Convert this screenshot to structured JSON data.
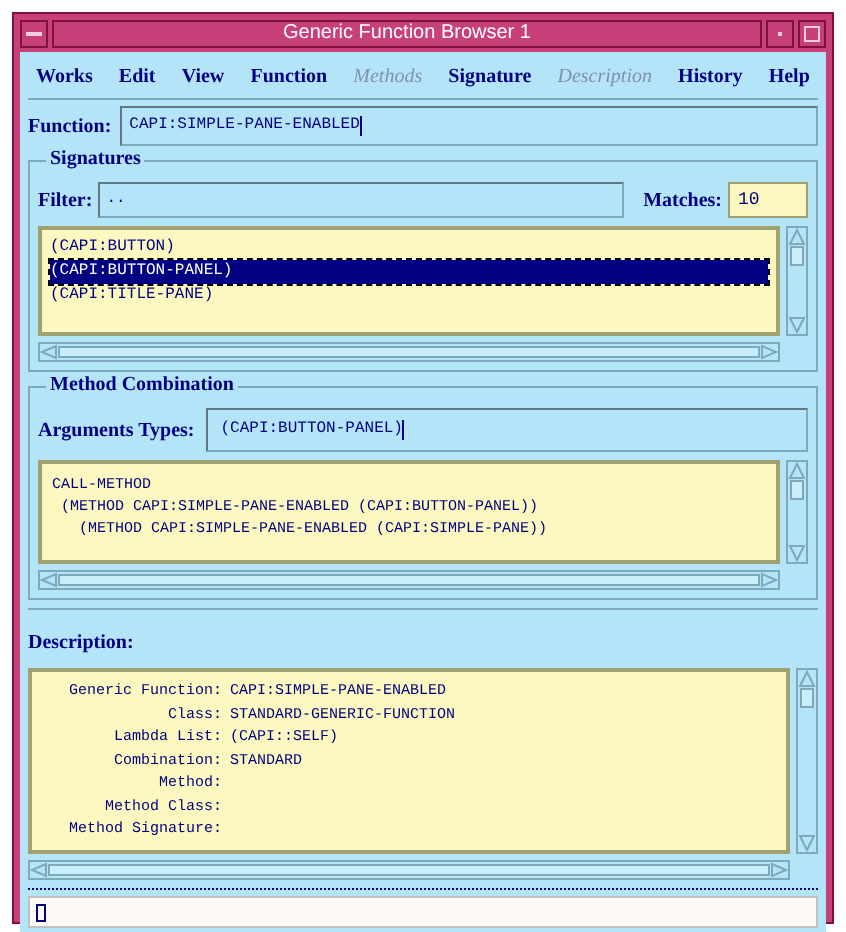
{
  "window": {
    "title": "Generic Function Browser 1"
  },
  "menu": [
    {
      "label": "Works",
      "disabled": false
    },
    {
      "label": "Edit",
      "disabled": false
    },
    {
      "label": "View",
      "disabled": false
    },
    {
      "label": "Function",
      "disabled": false
    },
    {
      "label": "Methods",
      "disabled": true
    },
    {
      "label": "Signature",
      "disabled": false
    },
    {
      "label": "Description",
      "disabled": true
    },
    {
      "label": "History",
      "disabled": false
    },
    {
      "label": "Help",
      "disabled": false
    }
  ],
  "function_field": {
    "label": "Function:",
    "value": "CAPI:SIMPLE-PANE-ENABLED"
  },
  "signatures": {
    "title": "Signatures",
    "filter_label": "Filter:",
    "filter_value": "..",
    "matches_label": "Matches:",
    "matches_value": "10",
    "items": [
      {
        "text": "(CAPI:BUTTON)",
        "selected": false
      },
      {
        "text": "(CAPI:BUTTON-PANEL)",
        "selected": true
      },
      {
        "text": "(CAPI:TITLE-PANE)",
        "selected": false
      }
    ]
  },
  "method_combination": {
    "title": "Method Combination",
    "arguments_label": "Arguments Types:",
    "arguments_value": "(CAPI:BUTTON-PANEL)",
    "lines": [
      "CALL-METHOD",
      " (METHOD CAPI:SIMPLE-PANE-ENABLED (CAPI:BUTTON-PANEL))",
      "   (METHOD CAPI:SIMPLE-PANE-ENABLED (CAPI:SIMPLE-PANE))"
    ]
  },
  "description": {
    "title": "Description:",
    "rows": [
      {
        "label": "Generic Function:",
        "value": "CAPI:SIMPLE-PANE-ENABLED"
      },
      {
        "label": "Class:",
        "value": "STANDARD-GENERIC-FUNCTION"
      },
      {
        "label": "Lambda List:",
        "value": "(CAPI::SELF)"
      },
      {
        "label": "Combination:",
        "value": "STANDARD"
      },
      {
        "label": "Method:"
      },
      {
        "label": "Method Class:"
      },
      {
        "label": "Method Signature:"
      }
    ]
  }
}
